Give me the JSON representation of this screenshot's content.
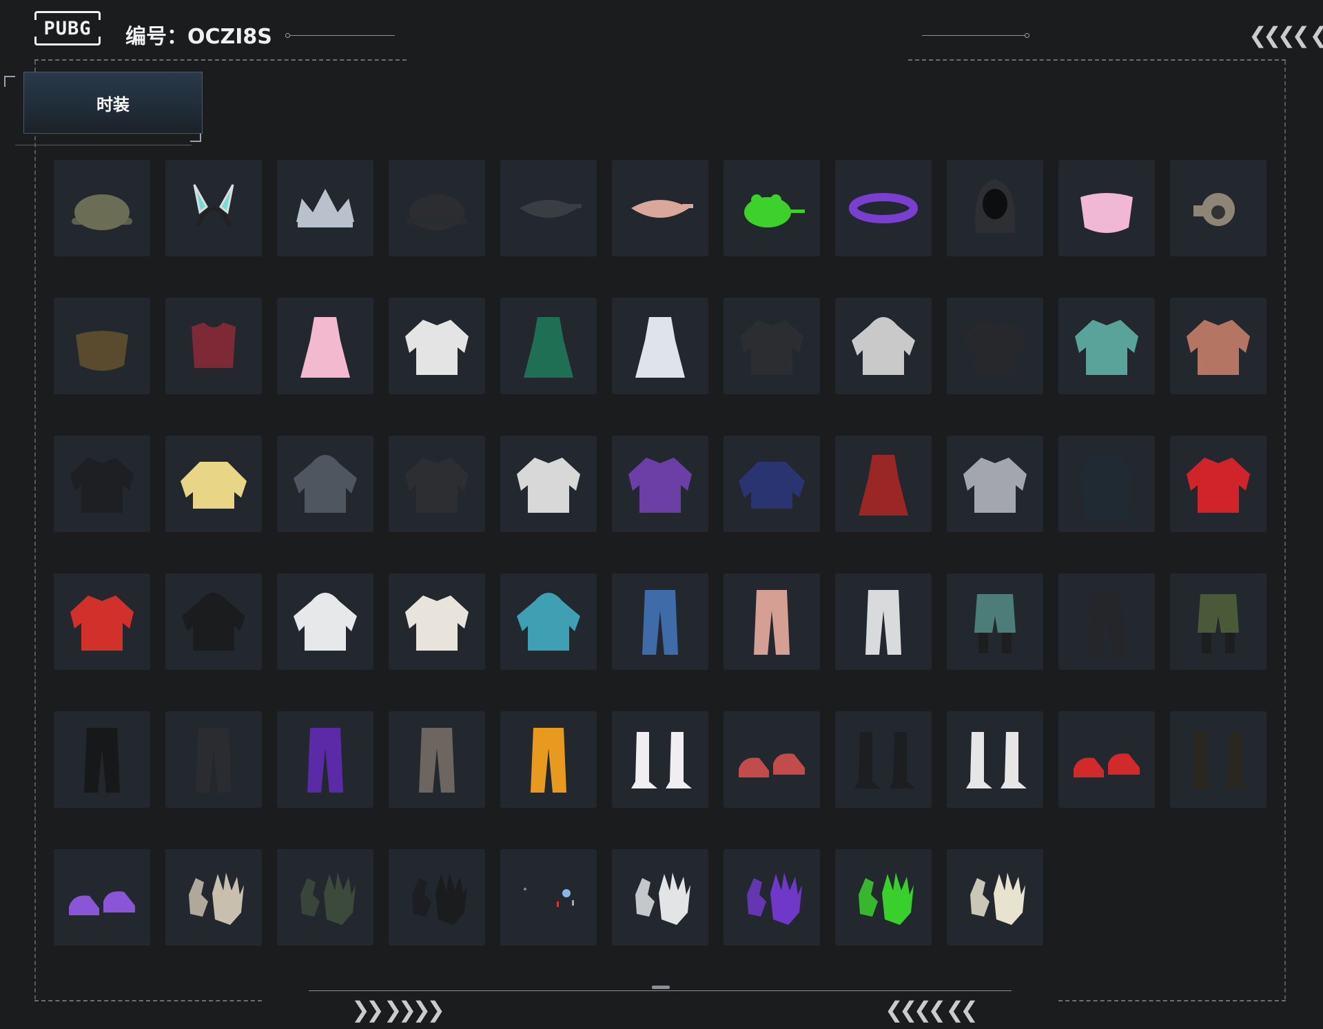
{
  "header": {
    "logo_text": "PUBG",
    "serial_text": "编号：OCZI8S"
  },
  "tabs": [
    {
      "label": "时装",
      "active": true
    }
  ],
  "decor": {
    "top_right_chevrons": "❮❮❮❮ ❮",
    "bottom_left_chevrons": "❯❯ ❯❯❯❯",
    "bottom_right_chevrons": "❮❮❮❮ ❮❮"
  },
  "colors": {
    "background": "#1b1c1e",
    "tile": "#23282f",
    "tab_gradient_top": "#2a3a4a",
    "accent_line": "#8c8f94"
  },
  "items": [
    {
      "name": "headset-cap-icon",
      "color": "#6b6e55",
      "shape": "hat"
    },
    {
      "name": "bunny-ears-headband-icon",
      "color": "#6fe0d6",
      "shape": "ears"
    },
    {
      "name": "silver-crown-icon",
      "color": "#b9c2cc",
      "shape": "crown"
    },
    {
      "name": "black-cap-icon",
      "color": "#2b2d30",
      "shape": "hat"
    },
    {
      "name": "black-goggles-icon",
      "color": "#3a3d42",
      "shape": "goggle"
    },
    {
      "name": "sleep-mask-icon",
      "color": "#d9a89a",
      "shape": "goggle"
    },
    {
      "name": "frog-mask-icon",
      "color": "#3fd12b",
      "shape": "frog"
    },
    {
      "name": "purple-visor-icon",
      "color": "#7a3fd0",
      "shape": "visor"
    },
    {
      "name": "black-balaclava-icon",
      "color": "#2d2f33",
      "shape": "hood"
    },
    {
      "name": "pink-face-mask-icon",
      "color": "#f1b8d6",
      "shape": "mask"
    },
    {
      "name": "gas-mask-icon",
      "color": "#8d8676",
      "shape": "gasmask"
    },
    {
      "name": "bandana-icon",
      "color": "#5a4a2e",
      "shape": "mask"
    },
    {
      "name": "sports-bra-22-icon",
      "color": "#7d2a36",
      "shape": "top"
    },
    {
      "name": "pink-qipao-icon",
      "color": "#f3b9cf",
      "shape": "dress"
    },
    {
      "name": "white-shirt-vest-icon",
      "color": "#e4e4e4",
      "shape": "jacket"
    },
    {
      "name": "green-dress-icon",
      "color": "#1f6f55",
      "shape": "dress"
    },
    {
      "name": "white-frill-dress-icon",
      "color": "#dfe3ea",
      "shape": "dress"
    },
    {
      "name": "black-lanyard-shirt-icon",
      "color": "#2b2d31",
      "shape": "jacket"
    },
    {
      "name": "red-hooded-top-icon",
      "color": "#c9c9c9",
      "shape": "hoodie"
    },
    {
      "name": "black-suit-shirt-icon",
      "color": "#26282b",
      "shape": "jacket"
    },
    {
      "name": "floral-shirt-icon",
      "color": "#5aa39a",
      "shape": "jacket"
    },
    {
      "name": "copper-jacket-icon",
      "color": "#b57563",
      "shape": "jacket"
    },
    {
      "name": "black-jacket-icon",
      "color": "#1e1f22",
      "shape": "jacket"
    },
    {
      "name": "yellow-fleece-icon",
      "color": "#e9d586",
      "shape": "sweater"
    },
    {
      "name": "grey-hoodie-icon",
      "color": "#4f5660",
      "shape": "hoodie"
    },
    {
      "name": "leather-jacket-icon",
      "color": "#2c2e31",
      "shape": "jacket"
    },
    {
      "name": "black-white-jacket-icon",
      "color": "#d8d8d8",
      "shape": "jacket"
    },
    {
      "name": "purple-bomber-icon",
      "color": "#6b3fa6",
      "shape": "jacket"
    },
    {
      "name": "navy-sweatshirt-icon",
      "color": "#2a3470",
      "shape": "sweater"
    },
    {
      "name": "floral-robe-icon",
      "color": "#9a2626",
      "shape": "dress"
    },
    {
      "name": "grey-orange-jacket-icon",
      "color": "#a3a7ad",
      "shape": "jacket"
    },
    {
      "name": "dark-coat-icon",
      "color": "#1f2a33",
      "shape": "coat"
    },
    {
      "name": "red-racing-jacket-icon",
      "color": "#d1242a",
      "shape": "jacket"
    },
    {
      "name": "red-varsity-jacket-icon",
      "color": "#d2302a",
      "shape": "jacket"
    },
    {
      "name": "black-print-hoodie-icon",
      "color": "#1b1c1e",
      "shape": "hoodie"
    },
    {
      "name": "white-hoodie-icon",
      "color": "#e6e8ea",
      "shape": "hoodie"
    },
    {
      "name": "orange-harness-jacket-icon",
      "color": "#e8e4dc",
      "shape": "jacket"
    },
    {
      "name": "teal-purple-hoodie-icon",
      "color": "#3f9fb3",
      "shape": "hoodie"
    },
    {
      "name": "blue-jeans-icon",
      "color": "#3f6ba8",
      "shape": "pants"
    },
    {
      "name": "pink-pants-icon",
      "color": "#d69f94",
      "shape": "pants"
    },
    {
      "name": "white-cargo-pants-icon",
      "color": "#d8dadc",
      "shape": "pants"
    },
    {
      "name": "teal-shorts-icon",
      "color": "#4c7d78",
      "shape": "shorts"
    },
    {
      "name": "black-chain-pants-icon",
      "color": "#24262a",
      "shape": "pants"
    },
    {
      "name": "olive-shorts-icon",
      "color": "#4a5a38",
      "shape": "shorts"
    },
    {
      "name": "black-track-pants-icon",
      "color": "#17181a",
      "shape": "pants"
    },
    {
      "name": "black-joggers-icon",
      "color": "#2a2c2f",
      "shape": "pants"
    },
    {
      "name": "purple-leggings-icon",
      "color": "#5b2aa6",
      "shape": "pants"
    },
    {
      "name": "camo-pants-icon",
      "color": "#6c6560",
      "shape": "pants"
    },
    {
      "name": "orange-pants-icon",
      "color": "#e79a1e",
      "shape": "pants"
    },
    {
      "name": "white-boots-icon",
      "color": "#f0eef0",
      "shape": "boots"
    },
    {
      "name": "red-sneakers-icon",
      "color": "#c24b4b",
      "shape": "shoes"
    },
    {
      "name": "black-boots-icon",
      "color": "#1d1e20",
      "shape": "boots"
    },
    {
      "name": "white-knee-boots-icon",
      "color": "#e8e5e6",
      "shape": "boots"
    },
    {
      "name": "red-high-tops-icon",
      "color": "#d22a2a",
      "shape": "shoes"
    },
    {
      "name": "black-combat-boots-icon",
      "color": "#2a2620",
      "shape": "boots"
    },
    {
      "name": "purple-sneakers-icon",
      "color": "#8a55d6",
      "shape": "shoes"
    },
    {
      "name": "skeleton-gloves-icon",
      "color": "#c9bfae",
      "shape": "gloves"
    },
    {
      "name": "tactical-gloves-icon",
      "color": "#3c4a3c",
      "shape": "gloves"
    },
    {
      "name": "black-fingerless-gloves-icon",
      "color": "#1b1c1e",
      "shape": "gloves"
    },
    {
      "name": "tiny-charms-icon",
      "color": "#8ab6e6",
      "shape": "charms"
    },
    {
      "name": "white-teal-gloves-icon",
      "color": "#e2e4e6",
      "shape": "gloves"
    },
    {
      "name": "purple-gloves-icon",
      "color": "#7038c8",
      "shape": "gloves"
    },
    {
      "name": "green-gloves-icon",
      "color": "#39d02e",
      "shape": "gloves"
    },
    {
      "name": "white-gold-gloves-icon",
      "color": "#e8e3cf",
      "shape": "gloves"
    }
  ]
}
